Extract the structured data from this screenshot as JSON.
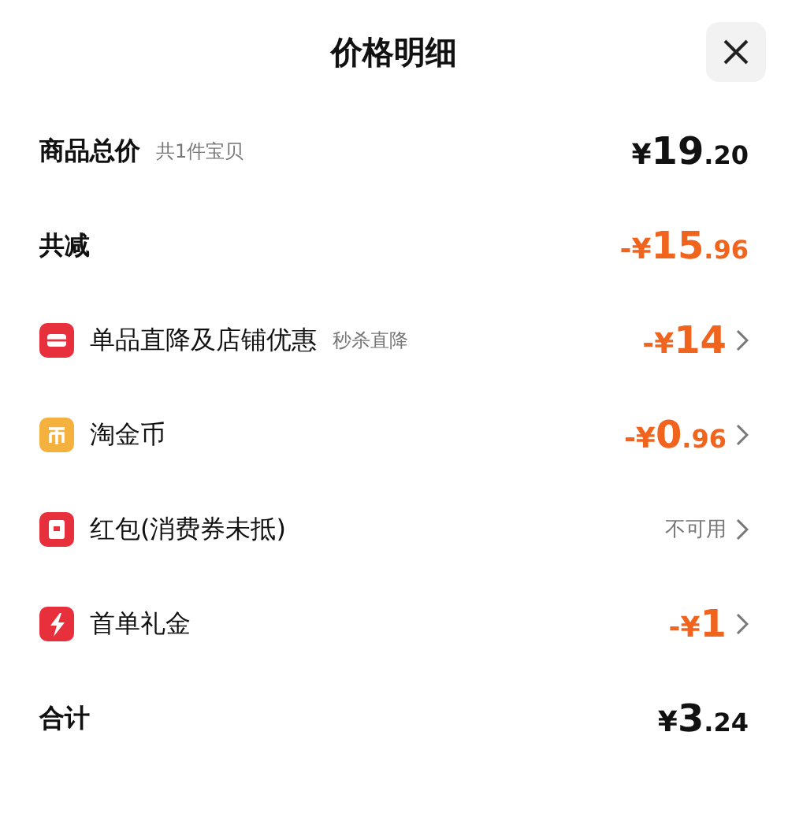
{
  "header": {
    "title": "价格明细"
  },
  "rows": [
    {
      "kind": "total",
      "label": "商品总价",
      "note": "共1件宝贝",
      "price": {
        "prefix": "¥",
        "main": "19",
        "decimal": ".20",
        "color": "#111111"
      }
    },
    {
      "kind": "total",
      "label": "共减",
      "price": {
        "prefix": "-¥",
        "main": "15",
        "decimal": ".96",
        "color": "#f0641e"
      }
    },
    {
      "kind": "discount",
      "label": "单品直降及店铺优惠",
      "note": "秒杀直降",
      "price": {
        "prefix": "-¥",
        "main": "14",
        "color": "#f0641e"
      }
    },
    {
      "kind": "discount",
      "label": "淘金币",
      "price": {
        "prefix": "-¥",
        "main": "0",
        "decimal": ".96",
        "color": "#f0641e"
      }
    },
    {
      "kind": "discount",
      "label": "红包(消费券未抵)",
      "status": "不可用"
    },
    {
      "kind": "discount",
      "label": "首单礼金",
      "price": {
        "prefix": "-¥",
        "main": "1",
        "color": "#f0641e"
      }
    },
    {
      "kind": "total",
      "label": "合计",
      "price": {
        "prefix": "¥",
        "main": "3",
        "decimal": ".24",
        "color": "#111111"
      }
    }
  ]
}
